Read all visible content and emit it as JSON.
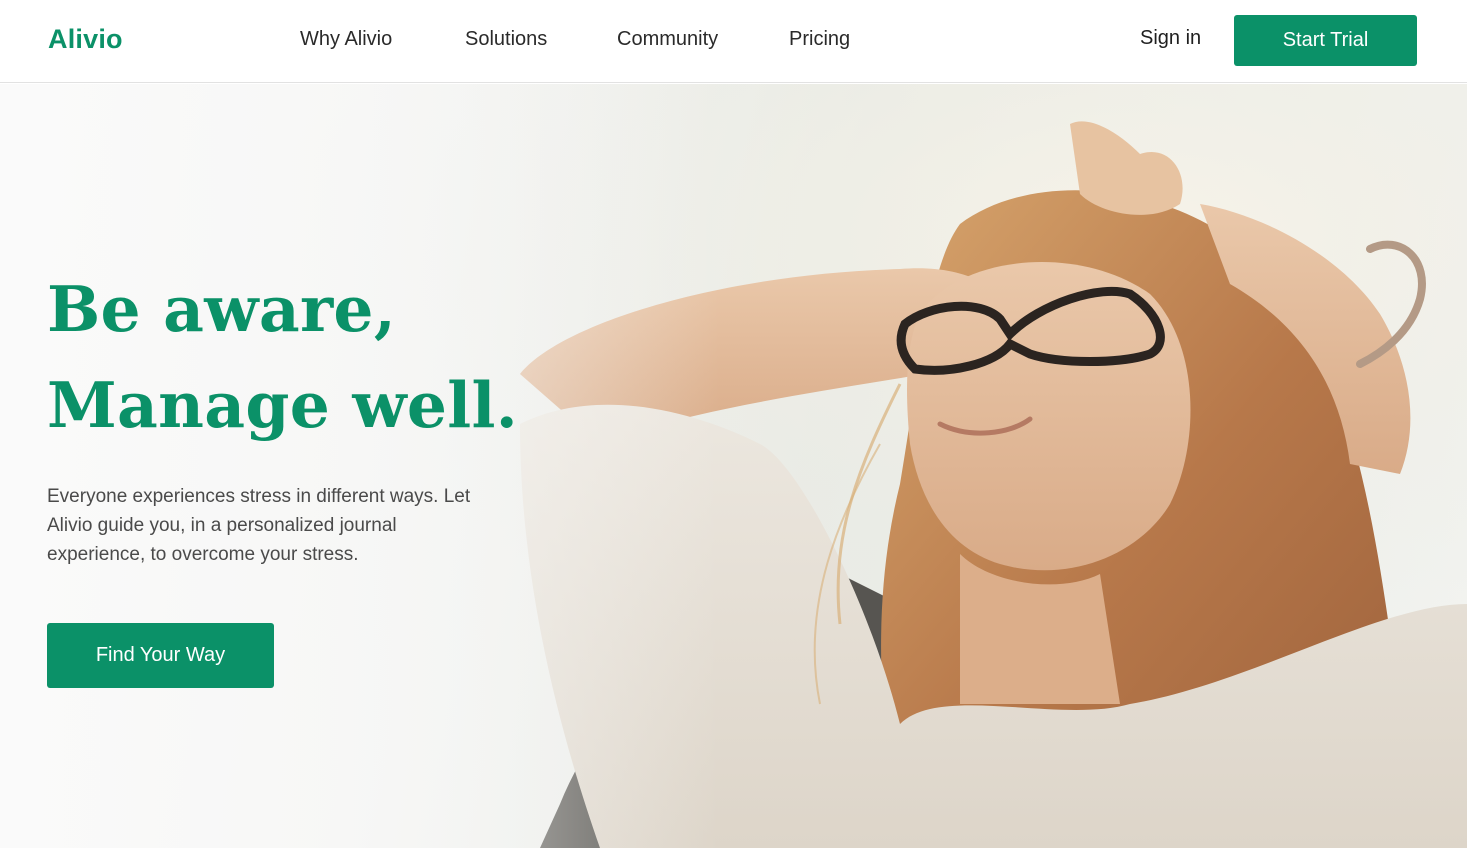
{
  "header": {
    "logo": "Alivio",
    "nav": [
      {
        "label": "Why Alivio"
      },
      {
        "label": "Solutions"
      },
      {
        "label": "Community"
      },
      {
        "label": "Pricing"
      }
    ],
    "sign_in": "Sign in",
    "start_trial": "Start Trial"
  },
  "hero": {
    "headline_line1": "Be aware,",
    "headline_line2": "Manage well.",
    "description": "Everyone experiences stress in different ways. Let Alivio guide you, in a personalized journal experience, to overcome your stress.",
    "cta": "Find Your Way",
    "image_icon": "hero-photo-woman-relaxing"
  },
  "colors": {
    "brand": "#0b9168",
    "text": "#2a2a2a",
    "muted": "#4a4a4a"
  }
}
